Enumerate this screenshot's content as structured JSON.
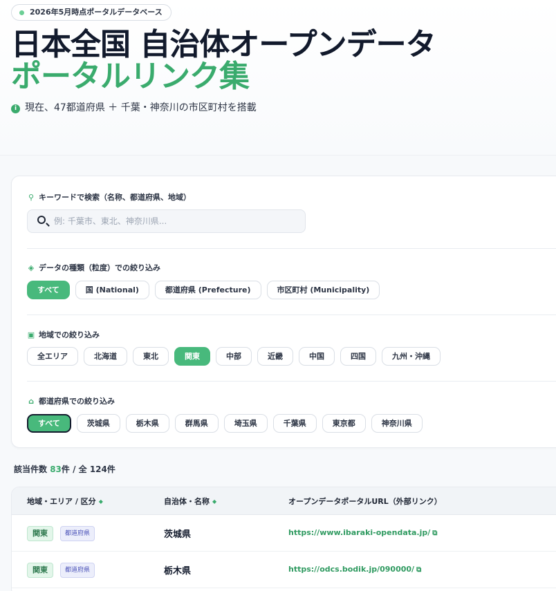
{
  "header": {
    "badge": "2026年5月時点ポータルデータベース",
    "title_line1": "日本全国 自治体オープンデータ",
    "title_line2": "ポータルリンク集",
    "subtitle": "現在、47都道府県 ＋ 千葉・神奈川の市区町村を搭載",
    "info_icon": "i"
  },
  "filters": {
    "search": {
      "label": "キーワードで検索（名称、都道府県、地域）",
      "placeholder": "例: 千葉市、東北、神奈川県...",
      "value": ""
    },
    "type": {
      "label": "データの種類（粒度）での絞り込み",
      "options": [
        "すべて",
        "国 (National)",
        "都道府県 (Prefecture)",
        "市区町村 (Municipality)"
      ],
      "selected_index": 0
    },
    "region": {
      "label": "地域での絞り込み",
      "options": [
        "全エリア",
        "北海道",
        "東北",
        "関東",
        "中部",
        "近畿",
        "中国",
        "四国",
        "九州・沖縄"
      ],
      "selected_index": 3
    },
    "prefecture": {
      "label": "都道府県での絞り込み",
      "options": [
        "すべて",
        "茨城県",
        "栃木県",
        "群馬県",
        "埼玉県",
        "千葉県",
        "東京都",
        "神奈川県"
      ],
      "selected_index": 0
    }
  },
  "results": {
    "prefix": "該当件数",
    "count": "83",
    "suffix": "件 / 全 124件"
  },
  "table": {
    "headers": [
      "地域・エリア / 区分",
      "自治体・名称",
      "オープンデータポータルURL（外部リンク）"
    ],
    "rows": [
      {
        "region": "関東",
        "level": "都道府県",
        "name": "茨城県",
        "url": "https://www.ibaraki-opendata.jp/"
      },
      {
        "region": "関東",
        "level": "都道府県",
        "name": "栃木県",
        "url": "https://odcs.bodik.jp/090000/"
      }
    ]
  },
  "icons": {
    "search_label": "search-icon",
    "type_label": "layers-icon",
    "region_label": "map-icon",
    "prefecture_label": "building-icon",
    "sort": "sort-icon",
    "external": "external-link-icon"
  },
  "colors": {
    "accent": "#3aab6d",
    "chip_active": "#48b97c",
    "title": "#121a2c"
  }
}
